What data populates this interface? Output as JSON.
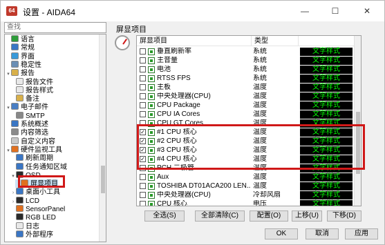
{
  "window": {
    "title": "设置 - AIDA64",
    "app_icon_text": "64",
    "minimize": "—",
    "maximize": "☐",
    "close": "✕"
  },
  "search": {
    "placeholder": "查找"
  },
  "tree": {
    "items": [
      {
        "label": "语言",
        "indent": 1,
        "color": "#2e9d3a",
        "expander": ""
      },
      {
        "label": "常规",
        "indent": 1,
        "color": "#3a76c4",
        "expander": ""
      },
      {
        "label": "界面",
        "indent": 1,
        "color": "#3a9ad9",
        "expander": ""
      },
      {
        "label": "稳定性",
        "indent": 1,
        "color": "#6b8fb5",
        "expander": ""
      },
      {
        "label": "报告",
        "indent": 1,
        "color": "#d8b04a",
        "expander": "▾"
      },
      {
        "label": "报告文件",
        "indent": 2,
        "color": "#e8e8e8",
        "expander": ""
      },
      {
        "label": "报告样式",
        "indent": 2,
        "color": "#e8e8e8",
        "expander": ""
      },
      {
        "label": "备注",
        "indent": 2,
        "color": "#d8b04a",
        "expander": ""
      },
      {
        "label": "电子邮件",
        "indent": 1,
        "color": "#4a7fc4",
        "expander": "▾"
      },
      {
        "label": "SMTP",
        "indent": 2,
        "color": "#888888",
        "expander": ""
      },
      {
        "label": "系统概述",
        "indent": 1,
        "color": "#3a76c4",
        "expander": ""
      },
      {
        "label": "内容筛选",
        "indent": 1,
        "color": "#8a8a8a",
        "expander": ""
      },
      {
        "label": "自定义内容",
        "indent": 1,
        "color": "#c8c8c8",
        "expander": ""
      },
      {
        "label": "硬件监视工具",
        "indent": 1,
        "color": "#e07020",
        "expander": "▾"
      },
      {
        "label": "刷新周期",
        "indent": 2,
        "color": "#3a76c4",
        "expander": ""
      },
      {
        "label": "任务通知区域",
        "indent": 2,
        "color": "#3a76c4",
        "expander": ""
      },
      {
        "label": "OSD",
        "indent": 2,
        "color": "#2a2a2a",
        "expander": "▾"
      },
      {
        "label": "屏显项目",
        "indent": 3,
        "color": "#e07020",
        "expander": "",
        "selected": true
      },
      {
        "label": "桌面小工具",
        "indent": 2,
        "color": "#3a76c4",
        "expander": "›"
      },
      {
        "label": "LCD",
        "indent": 2,
        "color": "#2a2a2a",
        "expander": "›"
      },
      {
        "label": "SensorPanel",
        "indent": 2,
        "color": "#e07020",
        "expander": ""
      },
      {
        "label": "RGB LED",
        "indent": 2,
        "color": "#2a2a2a",
        "expander": ""
      },
      {
        "label": "日志",
        "indent": 2,
        "color": "#e8e8e8",
        "expander": ""
      },
      {
        "label": "外部程序",
        "indent": 2,
        "color": "#3a76c4",
        "expander": ""
      }
    ]
  },
  "main": {
    "group_title": "屏显项目",
    "columns": [
      "屏显项目",
      "类型",
      ""
    ],
    "rows": [
      {
        "checked": false,
        "name": "垂直刷新率",
        "type": "系统",
        "style": "文字样式"
      },
      {
        "checked": false,
        "name": "主音量",
        "type": "系统",
        "style": "文字样式"
      },
      {
        "checked": false,
        "name": "电池",
        "type": "系统",
        "style": "文字样式"
      },
      {
        "checked": false,
        "name": "RTSS FPS",
        "type": "系统",
        "style": "文字样式"
      },
      {
        "checked": false,
        "name": "主板",
        "type": "温度",
        "style": "文字样式"
      },
      {
        "checked": false,
        "name": "中央处理器(CPU)",
        "type": "温度",
        "style": "文字样式"
      },
      {
        "checked": false,
        "name": "CPU Package",
        "type": "温度",
        "style": "文字样式"
      },
      {
        "checked": false,
        "name": "CPU IA Cores",
        "type": "温度",
        "style": "文字样式"
      },
      {
        "checked": false,
        "name": "CPU GT Cores",
        "type": "温度",
        "style": "文字样式"
      },
      {
        "checked": true,
        "name": "#1 CPU 核心",
        "type": "温度",
        "style": "文字样式"
      },
      {
        "checked": true,
        "name": "#2 CPU 核心",
        "type": "温度",
        "style": "文字样式"
      },
      {
        "checked": true,
        "name": "#3 CPU 核心",
        "type": "温度",
        "style": "文字样式"
      },
      {
        "checked": true,
        "name": "#4 CPU 核心",
        "type": "温度",
        "style": "文字样式"
      },
      {
        "checked": false,
        "name": "PCH 二极管",
        "type": "温度",
        "style": "文字样式"
      },
      {
        "checked": false,
        "name": "Aux",
        "type": "温度",
        "style": "文字样式"
      },
      {
        "checked": false,
        "name": "TOSHIBA DT01ACA200    LEN...",
        "type": "温度",
        "style": "文字样式"
      },
      {
        "checked": false,
        "name": "中央处理器(CPU)",
        "type": "冷却风扇",
        "style": "文字样式"
      },
      {
        "checked": false,
        "name": "CPU 核心",
        "type": "电压",
        "style": "文字样式"
      }
    ]
  },
  "buttons": {
    "select_all": "全选(S)",
    "clear_all": "全部清除(C)",
    "configure": "配置(O)",
    "move_up": "上移(U)",
    "move_down": "下移(D)",
    "ok": "OK",
    "cancel": "取消",
    "apply": "应用"
  }
}
